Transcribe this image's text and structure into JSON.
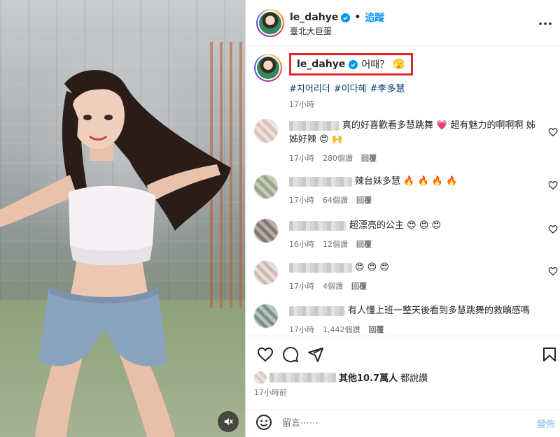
{
  "colors": {
    "accent": "#0095f6",
    "highlight_box": "#e0262e",
    "heart": "#e0245e",
    "text": "#262626",
    "muted": "#737373"
  },
  "media": {
    "mute_icon": "speaker-muted-icon"
  },
  "header": {
    "username": "le_dahye",
    "separator": "•",
    "follow_label": "追蹤",
    "location": "臺北大巨蛋",
    "more_icon": "more-options-icon"
  },
  "caption": {
    "username": "le_dahye",
    "text": "어때？",
    "emoji": "🫣",
    "hashtags": [
      "#치어리더",
      "#이다혜",
      "#李多慧"
    ],
    "time": "17小時"
  },
  "comments": [
    {
      "text": "真的好喜歡看多慧跳舞 💗 超有魅力的啊啊啊 姊姊好辣 😍 🙌",
      "time": "17小時",
      "likes": "280個讚",
      "reply": "回覆"
    },
    {
      "text": "辣台妹多慧 🔥 🔥 🔥 🔥",
      "time": "17小時",
      "likes": "64個讚",
      "reply": "回覆"
    },
    {
      "text": "超漂亮的公主 😍 😍 😍",
      "time": "16小時",
      "likes": "12個讚",
      "reply": "回覆"
    },
    {
      "text": "😍 😍 😍",
      "time": "17小時",
      "likes": "4個讚",
      "reply": "回覆"
    },
    {
      "text": "有人懂上班一整天後看到多慧跳舞的救贖感嗎",
      "time": "17小時",
      "likes": "1,442個讚",
      "reply": "回覆"
    }
  ],
  "actions": {
    "like_icon": "heart-icon",
    "comment_icon": "comment-icon",
    "share_icon": "send-icon",
    "save_icon": "bookmark-icon"
  },
  "likes_summary": {
    "others": "其他10.7萬人",
    "suffix": "都說讚"
  },
  "post_time": "17小時前",
  "comment_box": {
    "placeholder": "留言⋯⋯",
    "post_label": "發佈",
    "emoji_icon": "emoji-smile-icon"
  }
}
